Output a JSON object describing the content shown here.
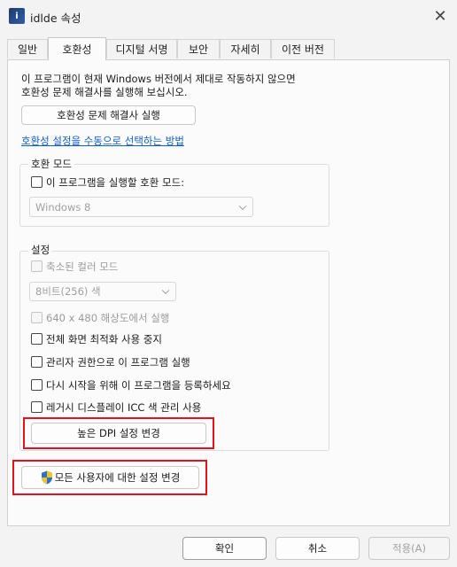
{
  "window": {
    "title": "idlde 속성",
    "close_glyph": "✕",
    "app_icon_glyph": "i"
  },
  "tabs": [
    {
      "label": "일반",
      "active": false
    },
    {
      "label": "호환성",
      "active": true
    },
    {
      "label": "디지털 서명",
      "active": false
    },
    {
      "label": "보안",
      "active": false
    },
    {
      "label": "자세히",
      "active": false
    },
    {
      "label": "이전 버전",
      "active": false
    }
  ],
  "compat": {
    "intro_line1": "이 프로그램이 현재 Windows 버전에서 제대로 작동하지 않으면",
    "intro_line2": "호환성 문제 해결사를 실행해 보십시오.",
    "run_troubleshooter_label": "호환성 문제 해결사 실행",
    "manual_link": "호환성 설정을 수동으로 선택하는 방법"
  },
  "compat_mode": {
    "group_title": "호환 모드",
    "checkbox_label": "이 프로그램을 실행할 호환 모드:",
    "checked": false,
    "os_select_value": "Windows 8"
  },
  "settings": {
    "group_title": "설정",
    "reduced_color_label": "축소된 컬러 모드",
    "color_select_value": "8비트(256) 색",
    "resolution_label": "640 x 480 해상도에서 실행",
    "fullscreen_label": "전체 화면 최적화 사용 중지",
    "admin_label": "관리자 권한으로 이 프로그램 실행",
    "restart_label": "다시 시작을 위해 이 프로그램을 등록하세요",
    "icc_label": "레거시 디스플레이 ICC 색 관리 사용",
    "high_dpi_button": "높은 DPI 설정 변경"
  },
  "all_users_button": "모든 사용자에 대한 설정 변경",
  "footer": {
    "ok": "확인",
    "cancel": "취소",
    "apply": "적용(A)"
  },
  "colors": {
    "highlight": "#e3121b",
    "link": "#0f5fc6"
  },
  "icons": [
    "app-icon",
    "close-icon",
    "checkbox-icon",
    "chevron-down-icon",
    "shield-icon"
  ]
}
